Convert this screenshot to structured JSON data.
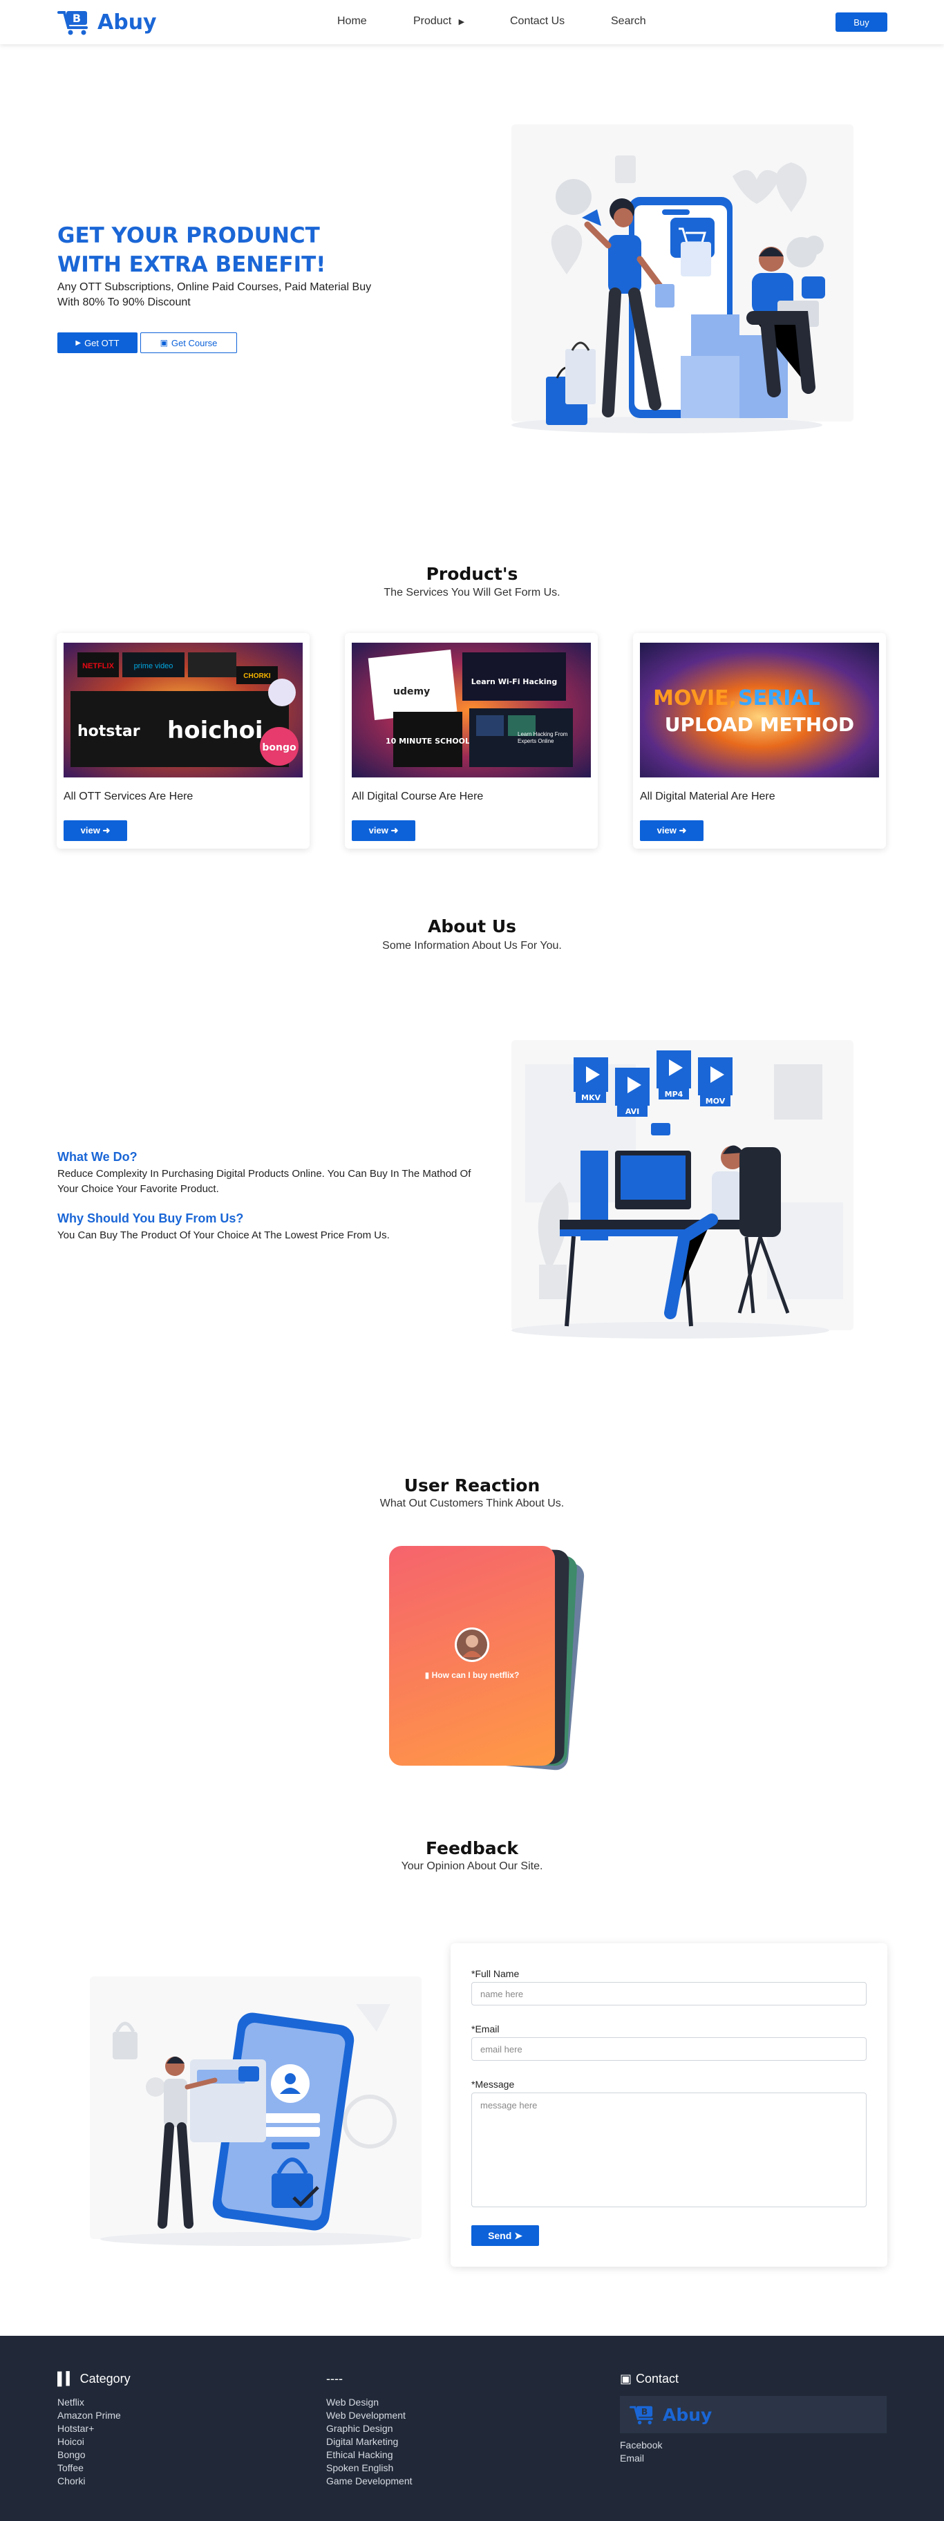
{
  "nav": {
    "brand": "Abuy",
    "links": {
      "home": "Home",
      "product": "Product",
      "contact": "Contact Us",
      "search": "Search"
    },
    "buy": "Buy"
  },
  "hero": {
    "title_line1": "GET YOUR PRODUNCT",
    "title_line2": "WITH EXTRA BENEFIT!",
    "subtitle": "Any OTT Subscriptions, Online Paid Courses, Paid Material Buy With 80% To 90% Discount",
    "btn_ott": "Get OTT",
    "btn_course": "Get Course"
  },
  "products": {
    "title": "Product's",
    "subtitle": "The Services You Will Get Form Us.",
    "cards": [
      {
        "text": "All OTT Services Are Here",
        "button": "view"
      },
      {
        "text": "All Digital Course Are Here",
        "button": "view"
      },
      {
        "text": "All Digital Material Are Here",
        "button": "view"
      }
    ],
    "thumb1": {
      "hotstar": "hotstar",
      "hoichoi": "hoichoi",
      "bongo": "bongo",
      "netflix": "NETFLIX",
      "prime": "prime video",
      "chorki": "CHORKI"
    },
    "thumb2": {
      "udemy": "udemy",
      "wifi": "Learn Wi-Fi Hacking",
      "school": "10 MINUTE SCHOOL",
      "hack": "Learn Hacking From Experts Online"
    },
    "thumb3": {
      "line1": "MOVIE,",
      "line1b": "SERIAL",
      "line2": "UPLOAD METHOD"
    }
  },
  "about": {
    "title": "About Us",
    "subtitle": "Some Information About Us For You.",
    "q1": "What We Do?",
    "a1": "Reduce Complexity In Purchasing Digital Products Online. You Can Buy In The Mathod Of Your Choice Your Favorite Product.",
    "q2": "Why Should You Buy From Us?",
    "a2": "You Can Buy The Product Of Your Choice At The Lowest Price From Us.",
    "file_tags": [
      "MKV",
      "AVI",
      "MP4",
      "MOV"
    ]
  },
  "reaction": {
    "title": "User Reaction",
    "subtitle": "What Out Customers Think About Us.",
    "quote": "How can I buy netflix?"
  },
  "feedback": {
    "title": "Feedback",
    "subtitle": "Your Opinion About Our Site.",
    "name_label": "*Full Name",
    "name_placeholder": "name here",
    "email_label": "*Email",
    "email_placeholder": "email here",
    "message_label": "*Message",
    "message_placeholder": "message here",
    "send": "Send"
  },
  "footer": {
    "category_title": "Category",
    "categories": [
      "Netflix",
      "Amazon Prime",
      "Hotstar+",
      "Hoicoi",
      "Bongo",
      "Toffee",
      "Chorki"
    ],
    "services_title": "----",
    "services": [
      "Web Design",
      "Web Development",
      "Graphic Design",
      "Digital Marketing",
      "Ethical Hacking",
      "Spoken English",
      "Game Development"
    ],
    "contact_title": "Contact",
    "contact_brand": "Abuy",
    "contacts": [
      "Facebook",
      "Email"
    ]
  },
  "colors": {
    "primary": "#0d62d9",
    "brand": "#1a66d6",
    "footer_bg": "#212938",
    "card_gradient_start": "#f5636d",
    "card_gradient_end": "#ff9a45"
  }
}
